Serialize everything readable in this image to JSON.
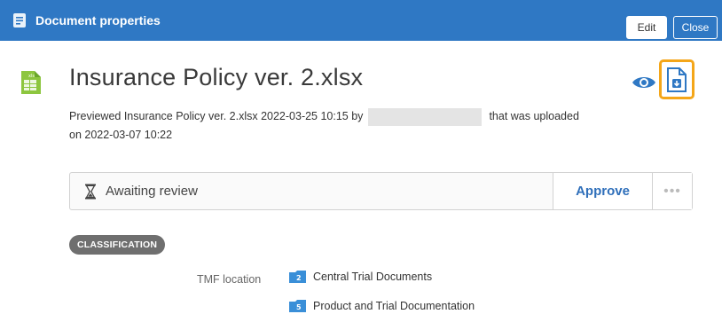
{
  "header": {
    "title": "Document properties",
    "edit_label": "Edit",
    "close_label": "Close"
  },
  "document": {
    "title": "Insurance Policy ver. 2.xlsx",
    "file_type": "xls",
    "preview_part1": "Previewed Insurance Policy ver. 2.xlsx 2022-03-25 10:15 by",
    "preview_part2": "that was uploaded",
    "preview_line2": "on 2022-03-07 10:22"
  },
  "status": {
    "label": "Awaiting review",
    "approve_label": "Approve",
    "more_label": "•••"
  },
  "classification": {
    "badge": "CLASSIFICATION",
    "tmf_label": "TMF location",
    "items": [
      {
        "number": "2",
        "label": "Central Trial Documents"
      },
      {
        "number": "5",
        "label": "Product and Trial Documentation"
      }
    ]
  },
  "colors": {
    "header_bg": "#2f78c4",
    "accent_highlight": "#f4a619",
    "approve_text": "#2f6fba",
    "file_icon": "#8dc63f"
  },
  "icons": [
    "document-icon",
    "spreadsheet-icon",
    "eye-icon",
    "download-icon",
    "hourglass-icon",
    "folder-icon"
  ]
}
